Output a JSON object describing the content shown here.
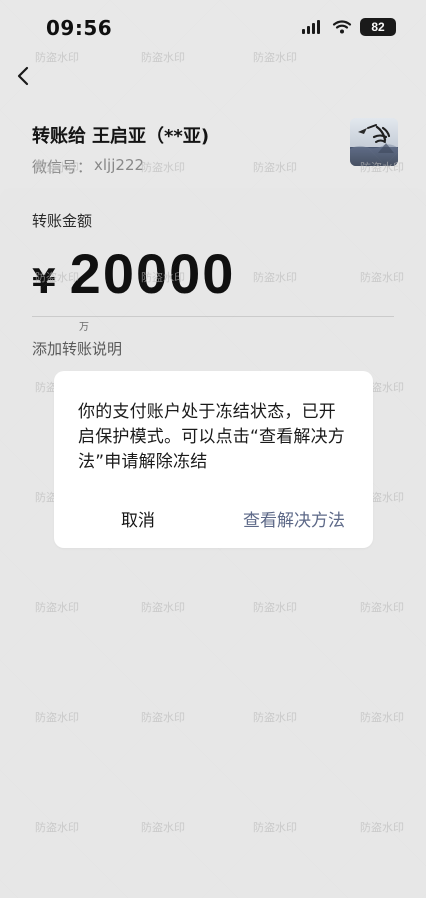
{
  "status_bar": {
    "time": "09:56",
    "battery": "82"
  },
  "header": {
    "payee_prefix": "转账给",
    "payee_name": "王启亚（**亚)",
    "wechat_label": "微信号：",
    "wechat_id": "xljj222"
  },
  "transfer": {
    "amount_label": "转账金额",
    "currency_symbol": "¥",
    "amount": "20000",
    "unit_hint": "万",
    "remark_link": "添加转账说明"
  },
  "dialog": {
    "message": "你的支付账户处于冻结状态，已开启保护模式。可以点击“查看解决方法”申请解除冻结",
    "cancel": "取消",
    "solution": "查看解决方法"
  },
  "watermark_text": "防盗水印",
  "colors": {
    "background": "#ededed",
    "dialog_background": "#ffffff",
    "primary_text": "#111111",
    "secondary_text": "#8c8c8c",
    "link_text": "#5d6988"
  },
  "icons": {
    "back": "chevron-left-icon",
    "signal": "signal-icon",
    "wifi": "wifi-icon",
    "battery": "battery-icon"
  }
}
